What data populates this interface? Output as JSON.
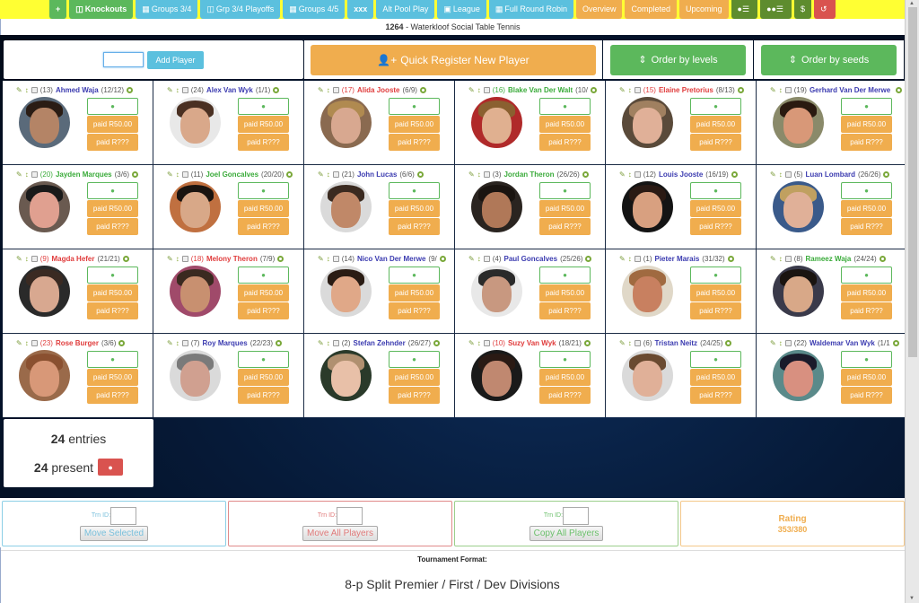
{
  "nav": {
    "items": [
      {
        "label": "+",
        "icon": "plus-icon",
        "color": "green",
        "bold": true
      },
      {
        "label": "Knockouts",
        "icon": "columns-icon",
        "color": "green",
        "bold": true
      },
      {
        "label": "Groups 3/4",
        "icon": "table-icon",
        "color": "blue"
      },
      {
        "label": "Grp 3/4 Playoffs",
        "icon": "columns-icon",
        "color": "blue"
      },
      {
        "label": "Groups 4/5",
        "icon": "table-icon",
        "color": "blue"
      },
      {
        "label": "xxx",
        "icon": "",
        "color": "blue",
        "bold": true
      },
      {
        "label": "Alt Pool Play",
        "icon": "",
        "color": "blue"
      },
      {
        "label": "League",
        "icon": "calendar-icon",
        "color": "blue"
      },
      {
        "label": "Full Round Robin",
        "icon": "table-icon",
        "color": "blue"
      },
      {
        "label": "Overview",
        "icon": "",
        "color": "orange"
      },
      {
        "label": "Completed",
        "icon": "",
        "color": "orange"
      },
      {
        "label": "Upcoming",
        "icon": "",
        "color": "orange"
      },
      {
        "label": "",
        "icon": "user-list-icon",
        "color": "dgreen"
      },
      {
        "label": "",
        "icon": "users-list-icon",
        "color": "dgreen"
      },
      {
        "label": "$",
        "icon": "",
        "color": "dgreen"
      },
      {
        "label": "",
        "icon": "undo-icon",
        "color": "red"
      }
    ]
  },
  "header": {
    "tournament_id": "1264",
    "tournament_name": " - Waterkloof Social Table Tennis"
  },
  "toolbar": {
    "add_player_input_value": "",
    "add_player_label": "Add Player",
    "quick_register_label": "Quick Register New Player",
    "order_by_levels_label": "Order by levels",
    "order_by_seeds_label": "Order by seeds"
  },
  "player_buttons": {
    "paid_amount_label": "paid R50.00",
    "paid_unknown_label": "paid R???"
  },
  "players": [
    {
      "seed": "(13)",
      "name": "Ahmed Waja",
      "record": "(12/12)",
      "color": "blue",
      "seed_color": "",
      "skin": "#b48466",
      "hair": "#2a1c14",
      "bg": "#5a6a7a"
    },
    {
      "seed": "(24)",
      "name": "Alex Van Wyk",
      "record": "(1/1)",
      "color": "blue",
      "seed_color": "",
      "skin": "#d9a88a",
      "hair": "#4a3022",
      "bg": "#e8e8e8"
    },
    {
      "seed": "(17)",
      "name": "Alida Jooste",
      "record": "(6/9)",
      "color": "red",
      "seed_color": "red",
      "skin": "#d8a890",
      "hair": "#b08a50",
      "bg": "#8a6a50"
    },
    {
      "seed": "(16)",
      "name": "Blake Van Der Walt",
      "record": "(10/",
      "color": "green",
      "seed_color": "green",
      "skin": "#e0b090",
      "hair": "#8a6030",
      "bg": "#b02a2a"
    },
    {
      "seed": "(15)",
      "name": "Elaine Pretorius",
      "record": "(8/13)",
      "color": "red",
      "seed_color": "red",
      "skin": "#e0b098",
      "hair": "#a08060",
      "bg": "#5a4a3a"
    },
    {
      "seed": "(19)",
      "name": "Gerhard Van Der Merwe",
      "record": "",
      "color": "blue",
      "seed_color": "",
      "skin": "#d89878",
      "hair": "#2a1a10",
      "bg": "#8a8a6a"
    },
    {
      "seed": "(20)",
      "name": "Jayden Marques",
      "record": "(3/6)",
      "color": "green",
      "seed_color": "green",
      "skin": "#e0a090",
      "hair": "#1a1a1a",
      "bg": "#6a5a50"
    },
    {
      "seed": "(11)",
      "name": "Joel Goncalves",
      "record": "(20/20)",
      "color": "green",
      "seed_color": "",
      "skin": "#d8a888",
      "hair": "#1a1410",
      "bg": "#c07040"
    },
    {
      "seed": "(21)",
      "name": "John Lucas",
      "record": "(6/6)",
      "color": "blue",
      "seed_color": "",
      "skin": "#c08868",
      "hair": "#3a2a20",
      "bg": "#dadada"
    },
    {
      "seed": "(3)",
      "name": "Jordan Theron",
      "record": "(26/26)",
      "color": "green",
      "seed_color": "",
      "skin": "#b07858",
      "hair": "#1a1410",
      "bg": "#2a2420"
    },
    {
      "seed": "(12)",
      "name": "Louis Jooste",
      "record": "(16/19)",
      "color": "blue",
      "seed_color": "",
      "skin": "#d8a080",
      "hair": "#2a1a14",
      "bg": "#141414"
    },
    {
      "seed": "(5)",
      "name": "Luan Lombard",
      "record": "(26/26)",
      "color": "blue",
      "seed_color": "",
      "skin": "#e0b098",
      "hair": "#c0a060",
      "bg": "#3a5a8a"
    },
    {
      "seed": "(9)",
      "name": "Magda Hefer",
      "record": "(21/21)",
      "color": "red",
      "seed_color": "red",
      "skin": "#d8a890",
      "hair": "#3a2a22",
      "bg": "#2a2a2a"
    },
    {
      "seed": "(18)",
      "name": "Melony Theron",
      "record": "(7/9)",
      "color": "red",
      "seed_color": "red",
      "skin": "#c89070",
      "hair": "#3a2a20",
      "bg": "#a04a6a"
    },
    {
      "seed": "(14)",
      "name": "Nico Van Der Merwe",
      "record": "(9/",
      "color": "blue",
      "seed_color": "",
      "skin": "#e0a888",
      "hair": "#2a1c14",
      "bg": "#dadada"
    },
    {
      "seed": "(4)",
      "name": "Paul Goncalves",
      "record": "(25/26)",
      "color": "blue",
      "seed_color": "",
      "skin": "#c89880",
      "hair": "#2a2a2a",
      "bg": "#e8e8e8"
    },
    {
      "seed": "(1)",
      "name": "Pieter Marais",
      "record": "(31/32)",
      "color": "blue",
      "seed_color": "",
      "skin": "#c88060",
      "hair": "#a06a40",
      "bg": "#e0d8c8"
    },
    {
      "seed": "(8)",
      "name": "Rameez Waja",
      "record": "(24/24)",
      "color": "green",
      "seed_color": "",
      "skin": "#d8a888",
      "hair": "#1a1410",
      "bg": "#3a3a4a"
    },
    {
      "seed": "(23)",
      "name": "Rose Burger",
      "record": "(3/6)",
      "color": "red",
      "seed_color": "red",
      "skin": "#d89878",
      "hair": "#8a5030",
      "bg": "#9a6a4a"
    },
    {
      "seed": "(7)",
      "name": "Roy Marques",
      "record": "(22/23)",
      "color": "blue",
      "seed_color": "",
      "skin": "#d0a090",
      "hair": "#7a7a7a",
      "bg": "#dadada"
    },
    {
      "seed": "(2)",
      "name": "Stefan Zehnder",
      "record": "(26/27)",
      "color": "blue",
      "seed_color": "",
      "skin": "#e8c0a8",
      "hair": "#b09070",
      "bg": "#2a3a2a"
    },
    {
      "seed": "(10)",
      "name": "Suzy Van Wyk",
      "record": "(18/21)",
      "color": "red",
      "seed_color": "red",
      "skin": "#c08870",
      "hair": "#2a1a14",
      "bg": "#1a1a1a"
    },
    {
      "seed": "(6)",
      "name": "Tristan Neitz",
      "record": "(24/25)",
      "color": "blue",
      "seed_color": "",
      "skin": "#e0b098",
      "hair": "#6a4a30",
      "bg": "#dadada"
    },
    {
      "seed": "(22)",
      "name": "Waldemar Van Wyk",
      "record": "(1/1",
      "color": "blue",
      "seed_color": "",
      "skin": "#d89080",
      "hair": "#1a1a2a",
      "bg": "#5a8a8a"
    }
  ],
  "summary": {
    "entries_count": "24",
    "entries_label": " entries",
    "present_count": "24",
    "present_label": " present"
  },
  "bottom_panels": {
    "move_selected": {
      "tm_label": "Trn ID:",
      "tm_value": "",
      "button": "Move Selected"
    },
    "move_all": {
      "tm_label": "Trn ID:",
      "tm_value": "",
      "button": "Move All Players"
    },
    "copy_all": {
      "tm_label": "Trn ID:",
      "tm_value": "",
      "button": "Copy All Players"
    },
    "rating": {
      "title": "Rating",
      "value": "353/380"
    }
  },
  "format": {
    "label": "Tournament Format:",
    "value": "8-p Split Premier / First / Dev Divisions"
  }
}
